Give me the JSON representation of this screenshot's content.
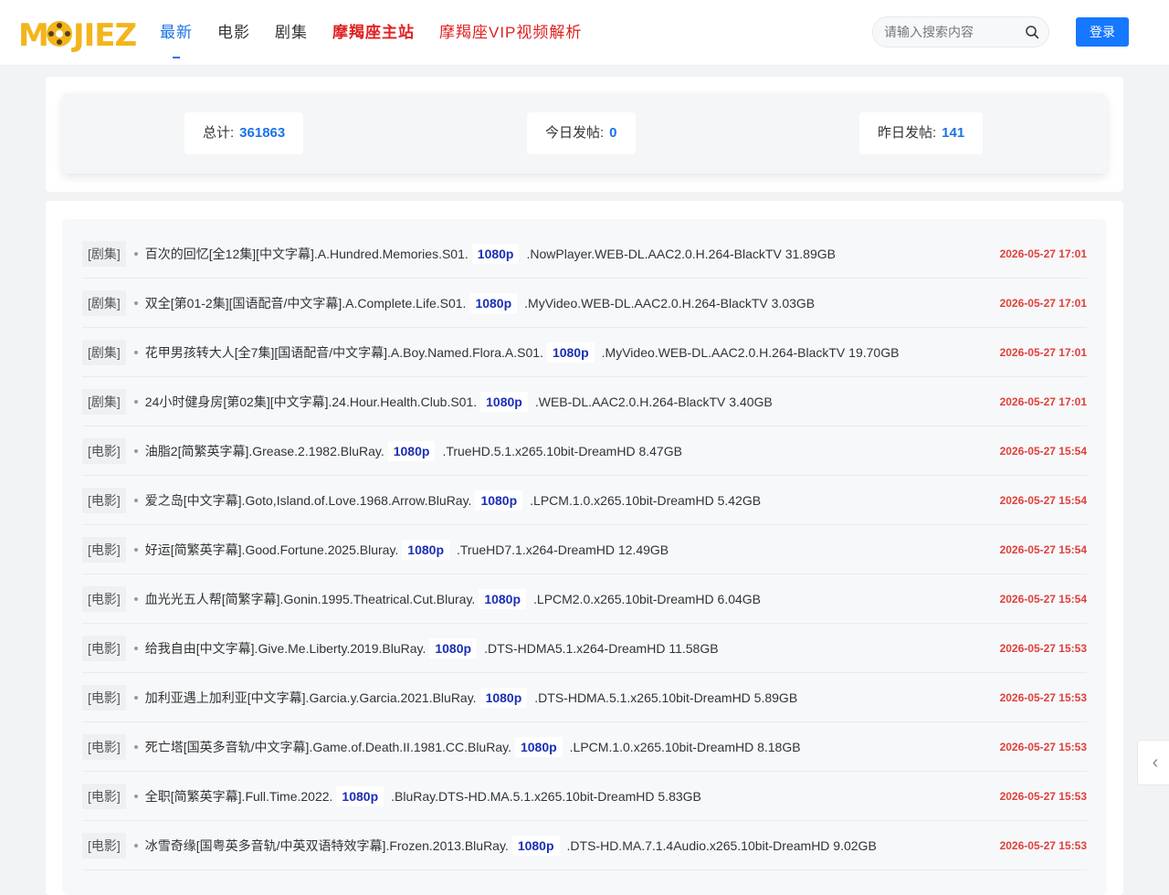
{
  "brand": {
    "logo_text": "MOJIEZ"
  },
  "nav": {
    "items": [
      {
        "label": "最新",
        "style": "active"
      },
      {
        "label": "电影",
        "style": ""
      },
      {
        "label": "剧集",
        "style": ""
      },
      {
        "label": "摩羯座主站",
        "style": "red"
      },
      {
        "label": "摩羯座VIP视频解析",
        "style": "red2"
      }
    ]
  },
  "search": {
    "placeholder": "请输入搜索内容",
    "value": ""
  },
  "login_label": "登录",
  "stats": [
    {
      "label": "总计:",
      "value": "361863"
    },
    {
      "label": "今日发帖:",
      "value": "0"
    },
    {
      "label": "昨日发帖:",
      "value": "141"
    }
  ],
  "list": [
    {
      "cat": "[剧集]",
      "pre": "百次的回忆[全12集][中文字幕].A.Hundred.Memories.S01.",
      "hl": "1080p",
      "post": ".NowPlayer.WEB-DL.AAC2.0.H.264-BlackTV 31.89GB",
      "date": "2026-05-27 17:01"
    },
    {
      "cat": "[剧集]",
      "pre": "双全[第01-2集][国语配音/中文字幕].A.Complete.Life.S01.",
      "hl": "1080p",
      "post": ".MyVideo.WEB-DL.AAC2.0.H.264-BlackTV 3.03GB",
      "date": "2026-05-27 17:01"
    },
    {
      "cat": "[剧集]",
      "pre": "花甲男孩转大人[全7集][国语配音/中文字幕].A.Boy.Named.Flora.A.S01.",
      "hl": "1080p",
      "post": ".MyVideo.WEB-DL.AAC2.0.H.264-BlackTV 19.70GB",
      "date": "2026-05-27 17:01"
    },
    {
      "cat": "[剧集]",
      "pre": "24小时健身房[第02集][中文字幕].24.Hour.Health.Club.S01.",
      "hl": "1080p",
      "post": ".WEB-DL.AAC2.0.H.264-BlackTV 3.40GB",
      "date": "2026-05-27 17:01"
    },
    {
      "cat": "[电影]",
      "pre": "油脂2[简繁英字幕].Grease.2.1982.BluRay.",
      "hl": "1080p",
      "post": ".TrueHD.5.1.x265.10bit-DreamHD 8.47GB",
      "date": "2026-05-27 15:54"
    },
    {
      "cat": "[电影]",
      "pre": "爱之岛[中文字幕].Goto,Island.of.Love.1968.Arrow.BluRay.",
      "hl": "1080p",
      "post": ".LPCM.1.0.x265.10bit-DreamHD 5.42GB",
      "date": "2026-05-27 15:54"
    },
    {
      "cat": "[电影]",
      "pre": "好运[简繁英字幕].Good.Fortune.2025.Bluray.",
      "hl": "1080p",
      "post": ".TrueHD7.1.x264-DreamHD 12.49GB",
      "date": "2026-05-27 15:54"
    },
    {
      "cat": "[电影]",
      "pre": "血光光五人帮[简繁字幕].Gonin.1995.Theatrical.Cut.Bluray.",
      "hl": "1080p",
      "post": ".LPCM2.0.x265.10bit-DreamHD 6.04GB",
      "date": "2026-05-27 15:54"
    },
    {
      "cat": "[电影]",
      "pre": "给我自由[中文字幕].Give.Me.Liberty.2019.BluRay.",
      "hl": "1080p",
      "post": ".DTS-HDMA5.1.x264-DreamHD 11.58GB",
      "date": "2026-05-27 15:53"
    },
    {
      "cat": "[电影]",
      "pre": "加利亚遇上加利亚[中文字幕].Garcia.y.Garcia.2021.BluRay.",
      "hl": "1080p",
      "post": ".DTS-HDMA.5.1.x265.10bit-DreamHD 5.89GB",
      "date": "2026-05-27 15:53"
    },
    {
      "cat": "[电影]",
      "pre": "死亡塔[国英多音轨/中文字幕].Game.of.Death.II.1981.CC.BluRay.",
      "hl": "1080p",
      "post": ".LPCM.1.0.x265.10bit-DreamHD 8.18GB",
      "date": "2026-05-27 15:53"
    },
    {
      "cat": "[电影]",
      "pre": "全职[简繁英字幕].Full.Time.2022.",
      "hl": "1080p",
      "post": ".BluRay.DTS-HD.MA.5.1.x265.10bit-DreamHD 5.83GB",
      "date": "2026-05-27 15:53"
    },
    {
      "cat": "[电影]",
      "pre": "冰雪奇缘[国粤英多音轨/中英双语特效字幕].Frozen.2013.BluRay.",
      "hl": "1080p",
      "post": ".DTS-HD.MA.7.1.4Audio.x265.10bit-DreamHD 9.02GB",
      "date": "2026-05-27 15:53"
    }
  ]
}
